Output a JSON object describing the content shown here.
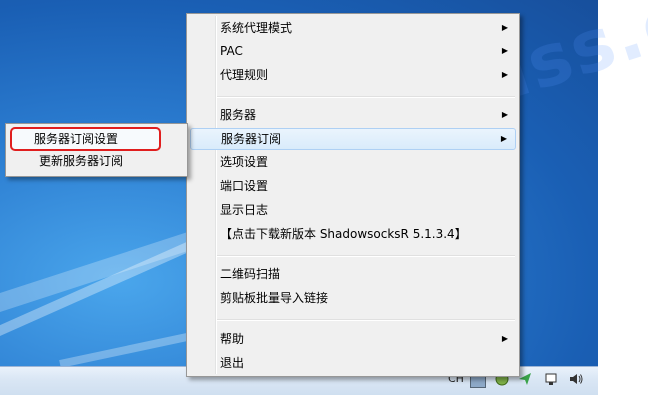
{
  "main_menu": {
    "items": [
      {
        "label": "系统代理模式",
        "submenu": true
      },
      {
        "label": "PAC",
        "submenu": true
      },
      {
        "label": "代理规则",
        "submenu": true
      },
      {
        "label": "服务器",
        "submenu": true
      },
      {
        "label": "服务器订阅",
        "submenu": true,
        "highlighted": true
      },
      {
        "label": "选项设置",
        "submenu": false
      },
      {
        "label": "端口设置",
        "submenu": false
      },
      {
        "label": "显示日志",
        "submenu": false
      },
      {
        "label": "【点击下载新版本 ShadowsocksR 5.1.3.4】",
        "submenu": false
      },
      {
        "label": "二维码扫描",
        "submenu": false
      },
      {
        "label": "剪贴板批量导入链接",
        "submenu": false
      },
      {
        "label": "帮助",
        "submenu": true
      },
      {
        "label": "退出",
        "submenu": false
      }
    ]
  },
  "sub_menu": {
    "items": [
      {
        "label": "服务器订阅设置",
        "highlighted": true
      },
      {
        "label": "更新服务器订阅"
      }
    ]
  },
  "arrow_glyph": "▶",
  "taskbar": {
    "lang": "CH"
  },
  "watermark": "worldss.com",
  "colors": {
    "highlight_border": "#e01e1e",
    "menu_bg": "#f0f0f0",
    "desktop": "#2b7cd0"
  }
}
